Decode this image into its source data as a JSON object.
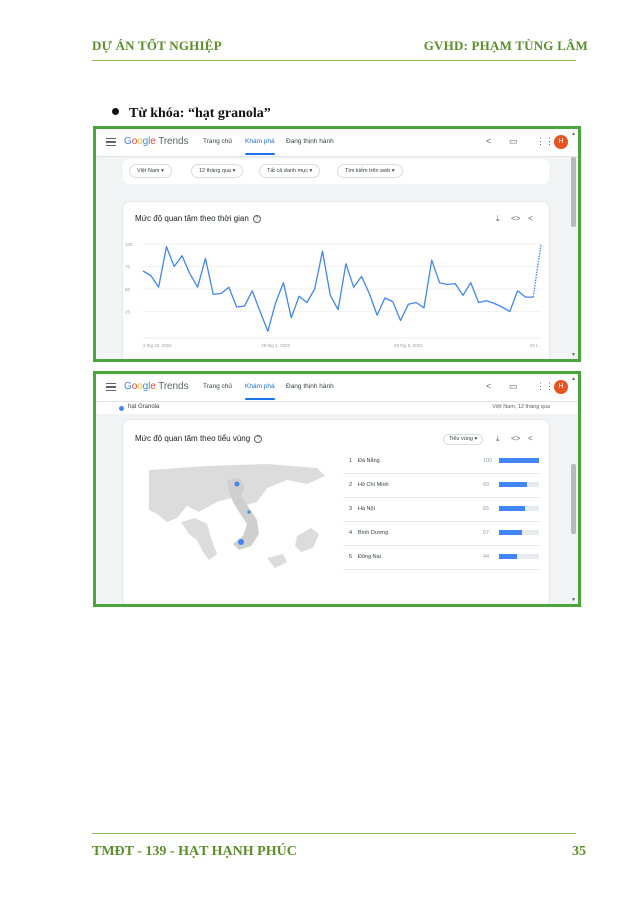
{
  "header": {
    "left": "DỰ ÁN TỐT NGHIỆP",
    "right": "GVHD: PHẠM TÙNG LÂM"
  },
  "bullet": {
    "text": "Từ khóa: “hạt granola”"
  },
  "trends": {
    "logo": {
      "g1": "G",
      "o1": "o",
      "o2": "o",
      "g2": "g",
      "l": "l",
      "e": "e",
      "word": "Trends"
    },
    "nav": [
      "Trang chủ",
      "Khám phá",
      "Đang thịnh hành"
    ],
    "active_nav": "Khám phá",
    "avatar": "H",
    "colors": {
      "accent": "#1a73e8",
      "series": "#4285f4",
      "avatar": "#e8541f",
      "frame": "#4aa53a"
    }
  },
  "shot1": {
    "filters": [
      "Việt Nam",
      "12 tháng qua",
      "Tất cả danh mục",
      "Tìm kiếm trên web"
    ],
    "card_title": "Mức độ quan tâm theo thời gian"
  },
  "chart_data": {
    "type": "line",
    "title": "Mức độ quan tâm theo thời gian",
    "xlabel": "",
    "ylabel": "",
    "ylim": [
      0,
      100
    ],
    "y_ticks": [
      100,
      75,
      50,
      25
    ],
    "x_tick_labels": [
      "2 thg 10, 2022",
      "29 thg 1, 2023",
      "28 thg 5, 2023",
      "24 t..."
    ],
    "x_tick_index": [
      0,
      17,
      34,
      51
    ],
    "grid": true,
    "legend": "none",
    "values": [
      70,
      65,
      52,
      97,
      75,
      87,
      67,
      52,
      84,
      44,
      45,
      52,
      30,
      31,
      48,
      25,
      3,
      35,
      57,
      18,
      42,
      35,
      50,
      92,
      43,
      27,
      78,
      52,
      64,
      45,
      21,
      40,
      36,
      15,
      33,
      35,
      29,
      82,
      57,
      55,
      56,
      43,
      57,
      35,
      37,
      34,
      30,
      25,
      48,
      41,
      41,
      100
    ],
    "partial_from_index": 50
  },
  "shot2": {
    "term": "hạt Granola",
    "term_meta": "Việt Nam, 12 tháng qua",
    "card_title": "Mức độ quan tâm theo tiểu vùng",
    "select": "Tiểu vùng",
    "regions": [
      {
        "rank": "1",
        "name": "Đà Nẵng",
        "value": 100
      },
      {
        "rank": "2",
        "name": "Hồ Chí Minh",
        "value": 69
      },
      {
        "rank": "3",
        "name": "Hà Nội",
        "value": 65
      },
      {
        "rank": "4",
        "name": "Bình Dương",
        "value": 57
      },
      {
        "rank": "5",
        "name": "Đồng Nai",
        "value": 44
      }
    ]
  },
  "footer": {
    "left": "TMĐT - 139 - HẠT HẠNH PHÚC",
    "page": "35"
  }
}
